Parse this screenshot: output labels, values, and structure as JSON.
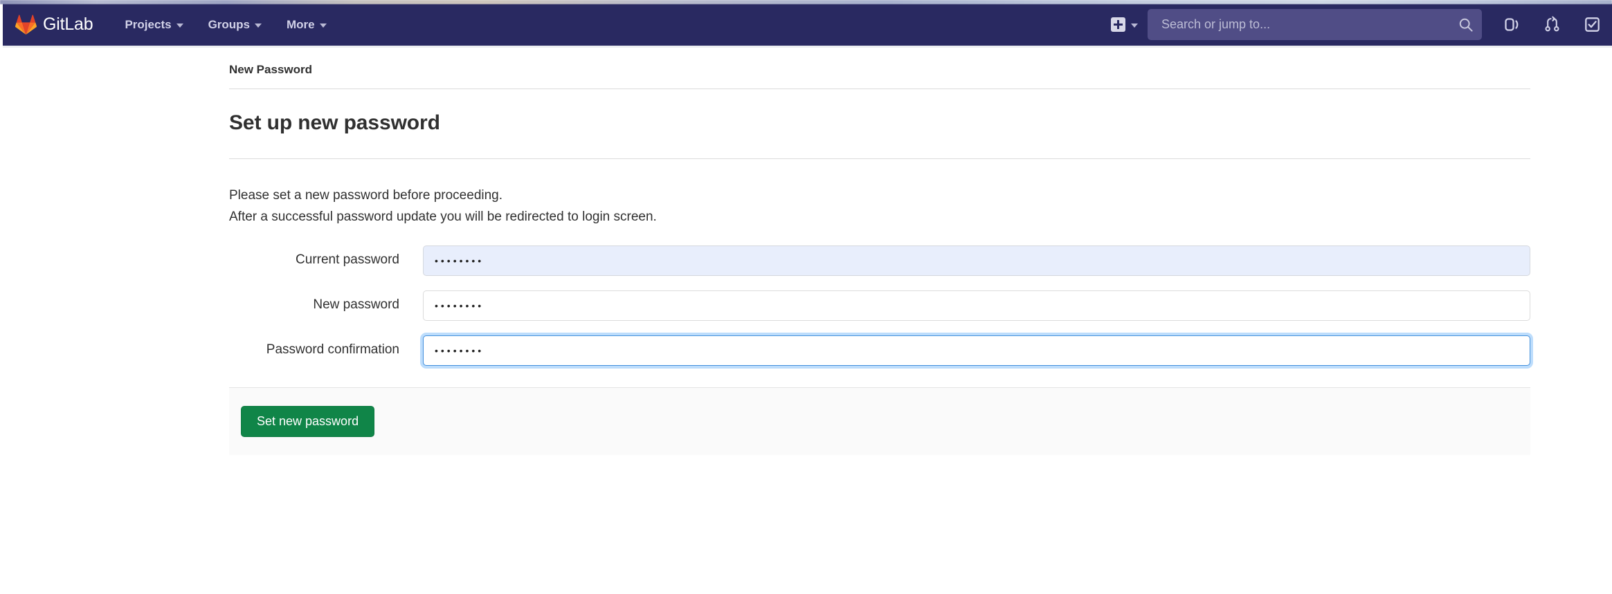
{
  "navbar": {
    "brand_name": "GitLab",
    "logo_icon": "gitlab-tanuki-icon",
    "items": [
      {
        "label": "Projects",
        "icon": "chevron-down-icon"
      },
      {
        "label": "Groups",
        "icon": "chevron-down-icon"
      },
      {
        "label": "More",
        "icon": "chevron-down-icon"
      }
    ],
    "create_new": {
      "icon": "plus-square-icon",
      "chevron": "chevron-down-icon"
    },
    "search": {
      "placeholder": "Search or jump to...",
      "value": "",
      "icon": "search-icon"
    },
    "right_icons": [
      {
        "name": "issues-icon"
      },
      {
        "name": "merge-requests-icon"
      },
      {
        "name": "todos-icon"
      }
    ],
    "colors": {
      "background": "#292961",
      "search_background": "#504d86",
      "text": "#d2d2e8"
    }
  },
  "breadcrumb": {
    "text": "New Password"
  },
  "main": {
    "title": "Set up new password",
    "intro_line_1": "Please set a new password before proceeding.",
    "intro_line_2": "After a successful password update you will be redirected to login screen."
  },
  "form": {
    "fields": [
      {
        "label": "Current password",
        "name": "current-password",
        "value": "••••••••",
        "masked_length": 8,
        "state": "autofilled"
      },
      {
        "label": "New password",
        "name": "new-password",
        "value": "••••••••",
        "masked_length": 8,
        "state": "filled"
      },
      {
        "label": "Password confirmation",
        "name": "password-confirmation",
        "value": "••••••••",
        "masked_length": 8,
        "state": "focused"
      }
    ],
    "submit_label": "Set new password",
    "submit_color": "#108548"
  }
}
